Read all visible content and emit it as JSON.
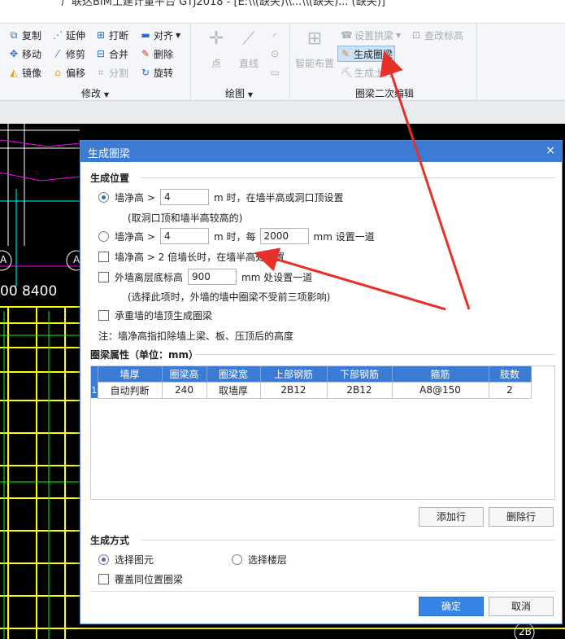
{
  "window": {
    "title": "广联达BIM土建计量平台 GTJ2018 - [E:\\\\(缺失)\\\\...\\\\(缺失)... (缺失)]"
  },
  "ribbon": {
    "modify": {
      "label": "修改",
      "items": [
        {
          "label": "复制",
          "icon": "copy-icon"
        },
        {
          "label": "移动",
          "icon": "move-icon"
        },
        {
          "label": "镜像",
          "icon": "mirror-icon"
        },
        {
          "label": "延伸",
          "icon": "extend-icon"
        },
        {
          "label": "修剪",
          "icon": "trim-icon"
        },
        {
          "label": "偏移",
          "icon": "offset-icon"
        },
        {
          "label": "打断",
          "icon": "break-icon"
        },
        {
          "label": "合并",
          "icon": "merge-icon"
        },
        {
          "label": "分割",
          "icon": "split-icon"
        },
        {
          "label": "对齐",
          "icon": "align-icon"
        },
        {
          "label": "删除",
          "icon": "delete-icon"
        },
        {
          "label": "旋转",
          "icon": "rotate-icon"
        }
      ]
    },
    "draw": {
      "label": "绘图",
      "items": [
        {
          "label": "点",
          "icon": "point-icon"
        },
        {
          "label": "直线",
          "icon": "line-icon"
        }
      ]
    },
    "ringbeam": {
      "label": "圈梁二次编辑",
      "smart_layout": "智能布置",
      "set_arch": "设置拱梁",
      "gen_ringbeam": "生成圈梁",
      "gen_earth": "生成土方",
      "check_elev": "查改标高"
    }
  },
  "cad": {
    "dim_text": "00  8400",
    "marks": [
      "A",
      "A",
      "2B"
    ]
  },
  "dialog": {
    "title": "生成圈梁",
    "close": "×",
    "position": {
      "heading": "生成位置",
      "opt1": {
        "prefix": "墙净高 >",
        "value": "4",
        "suffix": "m 时，在墙半高或洞口顶设置",
        "note": "(取洞口顶和墙半高较高的)",
        "checked": true
      },
      "opt2": {
        "prefix": "墙净高 >",
        "value": "4",
        "mid": "m 时，每",
        "value2": "2000",
        "suffix": "mm 设置一道",
        "checked": false
      },
      "opt3": {
        "label": "墙净高 > 2 倍墙长时，在墙半高处设置",
        "checked": false
      },
      "opt4": {
        "prefix": "外墙离层底标高",
        "value": "900",
        "suffix": "mm 处设置一道",
        "note": "(选择此项时，外墙的墙中圈梁不受前三项影响)",
        "checked": false
      },
      "opt5": {
        "label": "承重墙的墙顶生成圈梁",
        "checked": false
      },
      "footnote": "注：墙净高指扣除墙上梁、板、压顶后的高度"
    },
    "props": {
      "heading": "圈梁属性（单位：mm）",
      "columns": [
        "墙厚",
        "圈梁高",
        "圈梁宽",
        "上部钢筋",
        "下部钢筋",
        "箍筋",
        "肢数"
      ],
      "rows": [
        {
          "num": "1",
          "cells": [
            "自动判断",
            "240",
            "取墙厚",
            "2B12",
            "2B12",
            "A8@150",
            "2"
          ]
        }
      ],
      "add_row": "添加行",
      "del_row": "删除行"
    },
    "method": {
      "heading": "生成方式",
      "select_element": "选择图元",
      "select_floor": "选择楼层",
      "overwrite": "覆盖同位置圈梁"
    },
    "ok": "确定",
    "cancel": "取消"
  }
}
